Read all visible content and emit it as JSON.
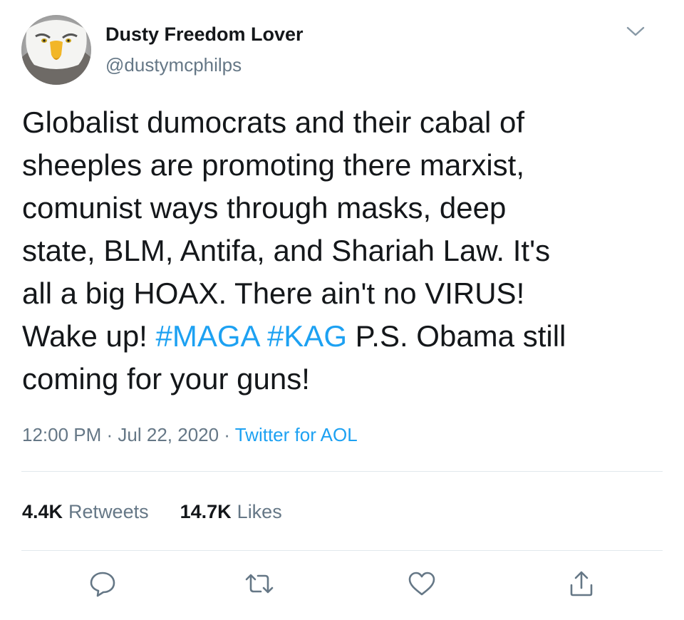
{
  "user": {
    "display_name": "Dusty Freedom Lover",
    "handle": "@dustymcphilps",
    "avatar_icon": "bald-eagle-avatar"
  },
  "tweet": {
    "lines": [
      [
        "Globalist dumocrats and their cabal of"
      ],
      [
        "sheeples are promoting there marxist,"
      ],
      [
        "comunist ways through masks, deep"
      ],
      [
        "state, BLM, Antifa, and Shariah Law. It's"
      ],
      [
        "all a big HOAX. There ain't no VIRUS!"
      ],
      [
        "Wake up! ",
        "#MAGA",
        " ",
        "#KAG",
        " P.S. Obama still"
      ],
      [
        "coming for your guns!"
      ]
    ],
    "hashtags": [
      "#MAGA",
      "#KAG"
    ]
  },
  "meta": {
    "time": "12:00 PM",
    "separator": " · ",
    "date": "Jul 22, 2020",
    "source": "Twitter for AOL"
  },
  "stats": {
    "retweets_count": "4.4K",
    "retweets_label": "Retweets",
    "likes_count": "14.7K",
    "likes_label": "Likes"
  },
  "actions": {
    "reply_icon": "comment-bubble-icon",
    "retweet_icon": "retweet-arrows-icon",
    "like_icon": "heart-icon",
    "share_icon": "share-upload-icon"
  },
  "colors": {
    "text": "#14171a",
    "secondary": "#657786",
    "accent": "#1da1f2",
    "divider": "#e1e8ed"
  }
}
